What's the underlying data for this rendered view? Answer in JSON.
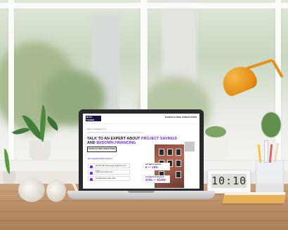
{
  "website": {
    "logo": "BLOC POWER",
    "top_cta": "SCHEDULE FREE CONSULTATION",
    "eyebrow": "Expert consultation for LA",
    "headline_part1": "TALK TO AN EXPERT ABOUT ",
    "headline_accent1": "PROJECT SAVINGS",
    "headline_part2": "AND ",
    "headline_accent2": "$0/DOWN FINANCING",
    "button_label": "SCHEDULE FREE CONSULTATION",
    "list_title": "Get connected with an expert to:",
    "list_items": [
      "Find the right clean energy project for your home",
      "Learn how to save more",
      "Get financing to cover costs"
    ],
    "stats": [
      {
        "label": "ESTIMATED SAVINGS",
        "value": "6 — 18%"
      },
      {
        "label": "ESTIMATED INCENTIVES",
        "value": "$75k — $120k"
      }
    ]
  },
  "clock": {
    "time": "10:10"
  },
  "colors": {
    "accent_purple": "#6b2cf5",
    "navy": "#14103a",
    "lamp_orange": "#e38e16",
    "desk_wood": "#b98e66"
  }
}
